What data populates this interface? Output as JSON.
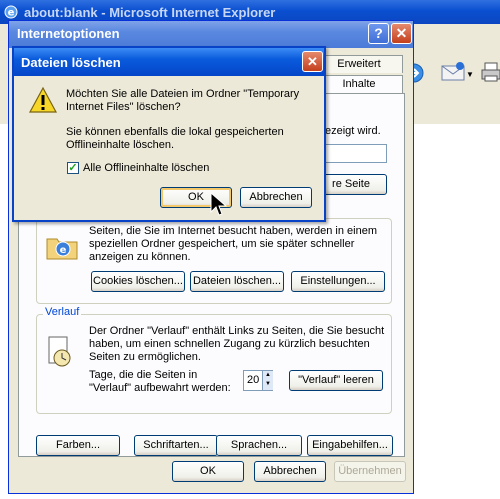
{
  "ie_window": {
    "title": "about:blank - Microsoft Internet Explorer"
  },
  "internet_options": {
    "title": "Internetoptionen",
    "tabs": [
      "Erweitert",
      "Inhalte"
    ],
    "partial_text": "ezeigt wird.",
    "partial_button": "re Seite",
    "temp_files": {
      "description": "Seiten, die Sie im Internet besucht haben, werden in einem speziellen Ordner gespeichert, um sie später schneller anzeigen zu können.",
      "buttons": [
        "Cookies löschen...",
        "Dateien löschen...",
        "Einstellungen..."
      ]
    },
    "history": {
      "label": "Verlauf",
      "description": "Der Ordner \"Verlauf\" enthält Links zu Seiten, die Sie besucht haben, um einen schnellen Zugang zu kürzlich besuchten Seiten zu ermöglichen.",
      "days_label": "Tage, die die Seiten in \"Verlauf\" aufbewahrt werden:",
      "days_value": "20",
      "clear_button": "\"Verlauf\" leeren"
    },
    "bottom_buttons": [
      "Farben...",
      "Schriftarten...",
      "Sprachen...",
      "Eingabehilfen..."
    ],
    "dialog_buttons": {
      "ok": "OK",
      "cancel": "Abbrechen",
      "apply": "Übernehmen"
    }
  },
  "delete_files_dialog": {
    "title": "Dateien löschen",
    "question": "Möchten Sie alle Dateien im Ordner \"Temporary Internet Files\" löschen?",
    "info": "Sie können ebenfalls die lokal gespeicherten Offlineinhalte löschen.",
    "checkbox_label": "Alle Offlineinhalte löschen",
    "checkbox_checked": true,
    "ok": "OK",
    "cancel": "Abbrechen"
  },
  "colors": {
    "xp_blue": "#0842c6",
    "dialog_face": "#ece9d8",
    "close_red": "#c4401c"
  },
  "icons": [
    "ie-logo-icon",
    "go-icon",
    "mail-icon",
    "print-icon",
    "help-icon",
    "close-icon",
    "warning-icon",
    "temp-files-icon",
    "history-icon",
    "cursor-icon"
  ]
}
